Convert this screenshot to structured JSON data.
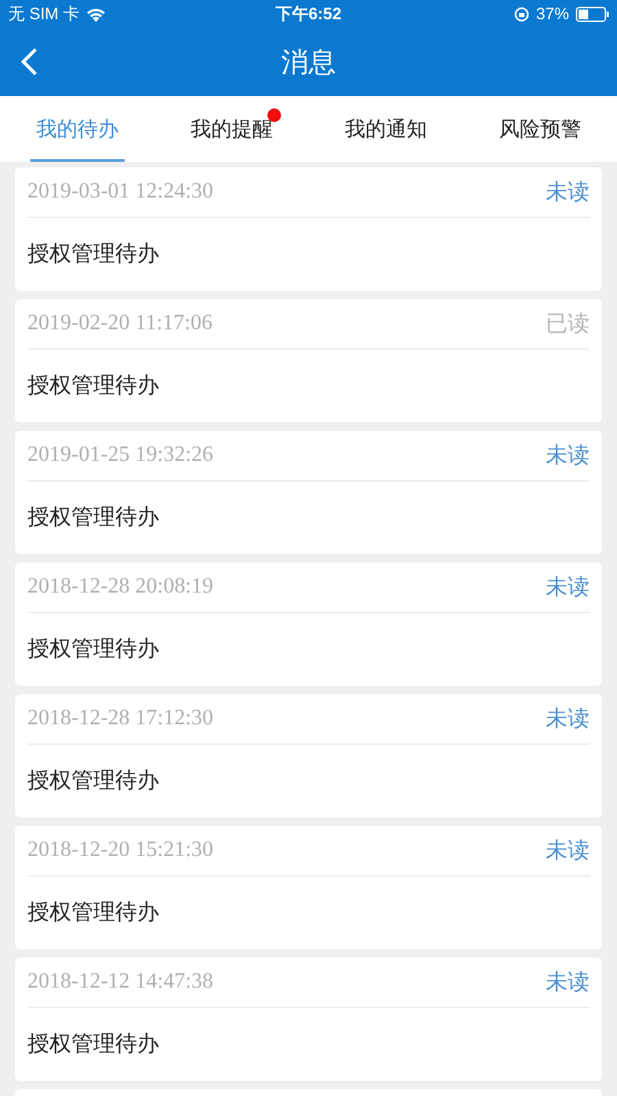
{
  "status_bar": {
    "carrier": "无 SIM 卡",
    "time": "下午6:52",
    "battery": "37%"
  },
  "nav": {
    "title": "消息"
  },
  "tabs": [
    {
      "label": "我的待办",
      "selected": true,
      "badge": false
    },
    {
      "label": "我的提醒",
      "selected": false,
      "badge": true
    },
    {
      "label": "我的通知",
      "selected": false,
      "badge": false
    },
    {
      "label": "风险预警",
      "selected": false,
      "badge": false
    }
  ],
  "messages": [
    {
      "time": "2019-03-01 12:24:30",
      "status": "未读",
      "read": false,
      "title": "授权管理待办"
    },
    {
      "time": "2019-02-20 11:17:06",
      "status": "已读",
      "read": true,
      "title": "授权管理待办"
    },
    {
      "time": "2019-01-25 19:32:26",
      "status": "未读",
      "read": false,
      "title": "授权管理待办"
    },
    {
      "time": "2018-12-28 20:08:19",
      "status": "未读",
      "read": false,
      "title": "授权管理待办"
    },
    {
      "time": "2018-12-28 17:12:30",
      "status": "未读",
      "read": false,
      "title": "授权管理待办"
    },
    {
      "time": "2018-12-20 15:21:30",
      "status": "未读",
      "read": false,
      "title": "授权管理待办"
    },
    {
      "time": "2018-12-12 14:47:38",
      "status": "未读",
      "read": false,
      "title": "授权管理待办"
    }
  ]
}
